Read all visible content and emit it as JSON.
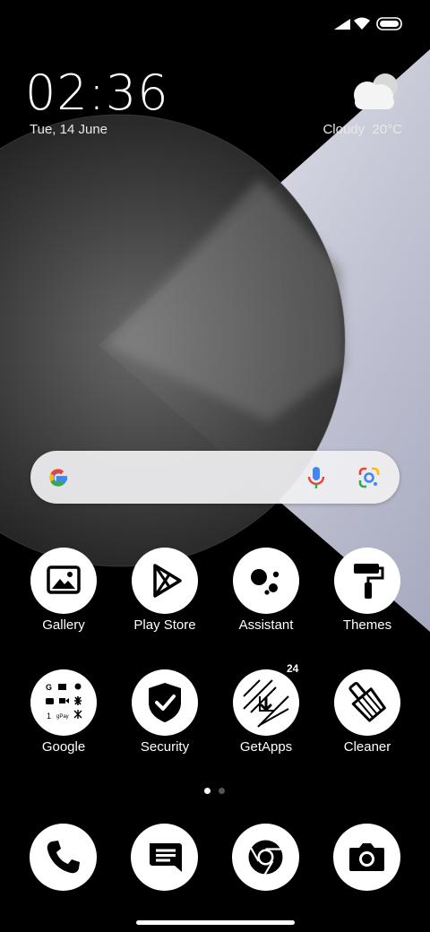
{
  "status_bar": {
    "icons": [
      "cellular-signal-icon",
      "wifi-icon",
      "battery-icon"
    ]
  },
  "clock": {
    "time": "02:36",
    "date": "Tue, 14 June"
  },
  "weather": {
    "condition": "Cloudy",
    "temperature": "20°C",
    "icon": "cloud-icon"
  },
  "search_bar": {
    "icons": [
      "google-logo-icon",
      "microphone-icon",
      "google-lens-icon"
    ]
  },
  "apps": [
    {
      "name": "gallery",
      "label": "Gallery",
      "icon": "image-icon"
    },
    {
      "name": "play-store",
      "label": "Play Store",
      "icon": "play-triangle-icon"
    },
    {
      "name": "assistant",
      "label": "Assistant",
      "icon": "assistant-dots-icon"
    },
    {
      "name": "themes",
      "label": "Themes",
      "icon": "paint-roller-icon"
    },
    {
      "name": "google",
      "label": "Google",
      "icon": "google-folder-icon"
    },
    {
      "name": "security",
      "label": "Security",
      "icon": "shield-check-icon"
    },
    {
      "name": "getapps",
      "label": "GetApps",
      "icon": "getapps-icon",
      "badge": "24"
    },
    {
      "name": "cleaner",
      "label": "Cleaner",
      "icon": "broom-icon"
    }
  ],
  "page_indicator": {
    "pages": 2,
    "current": 1
  },
  "dock": [
    {
      "name": "phone",
      "icon": "phone-icon"
    },
    {
      "name": "messages",
      "icon": "message-icon"
    },
    {
      "name": "chrome",
      "icon": "chrome-icon"
    },
    {
      "name": "camera",
      "icon": "camera-icon"
    }
  ],
  "colors": {
    "background": "#000000",
    "foreground": "#ffffff",
    "google_blue": "#4285F4",
    "google_red": "#EA4335",
    "google_yellow": "#FBBC05",
    "google_green": "#34A853"
  }
}
